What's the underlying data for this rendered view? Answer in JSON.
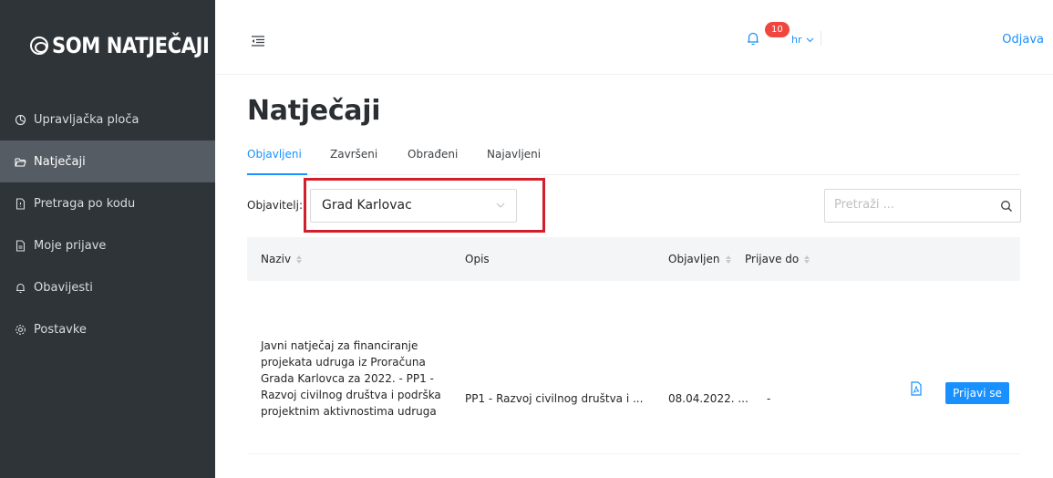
{
  "app": {
    "logo_text": "SOM NATJEČAJI"
  },
  "sidebar": {
    "items": [
      {
        "label": "Upravljačka ploča",
        "icon": "dashboard-icon",
        "active": false
      },
      {
        "label": "Natječaji",
        "icon": "folder-open-icon",
        "active": true
      },
      {
        "label": "Pretraga po kodu",
        "icon": "file-search-icon",
        "active": false
      },
      {
        "label": "Moje prijave",
        "icon": "file-icon",
        "active": false
      },
      {
        "label": "Obavijesti",
        "icon": "bell-icon",
        "active": false
      },
      {
        "label": "Postavke",
        "icon": "gear-icon",
        "active": false
      }
    ]
  },
  "header": {
    "notification_count": "10",
    "language": "hr",
    "logout_label": "Odjava"
  },
  "main": {
    "title": "Natječaji",
    "tabs": [
      {
        "label": "Objavljeni",
        "active": true
      },
      {
        "label": "Završeni",
        "active": false
      },
      {
        "label": "Obrađeni",
        "active": false
      },
      {
        "label": "Najavljeni",
        "active": false
      }
    ],
    "filter": {
      "label": "Objavitelj:",
      "value": "Grad Karlovac"
    },
    "search": {
      "placeholder": "Pretraži ..."
    },
    "table": {
      "columns": [
        "Naziv",
        "Opis",
        "Objavljen",
        "Prijave do"
      ],
      "rows": [
        {
          "name": "Javni natječaj za financiranje projekata udruga iz Proračuna Grada Karlovca za 2022. - PP1 - Razvoj civilnog društva i podrška projektnim aktivnostima udruga",
          "description": "PP1 - Razvoj civilnog društva i ...",
          "published": "08.04.2022. ...",
          "due": "-",
          "action_label": "Prijavi se"
        }
      ]
    }
  },
  "colors": {
    "sidebar_bg": "#2f3439",
    "sidebar_active": "#565c63",
    "accent": "#1890ff",
    "badge": "#f0463f",
    "highlight": "#d1202c"
  }
}
